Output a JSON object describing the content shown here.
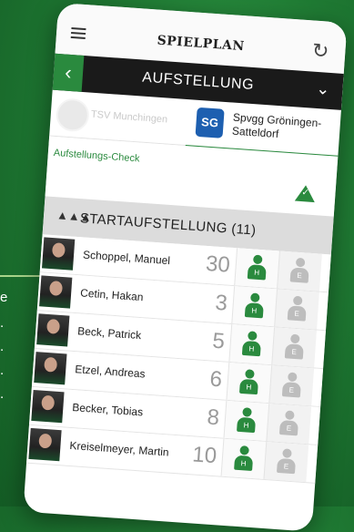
{
  "app": {
    "title": "SPIELPLAN"
  },
  "nav": {
    "section_title": "AUFSTELLUNG"
  },
  "teams": {
    "home": {
      "name": "TSV Munchingen"
    },
    "away": {
      "name": "Spvgg Gröningen-Satteldorf",
      "logo_text": "SG"
    }
  },
  "check": {
    "label": "Aufstellungs-Check"
  },
  "lineup": {
    "title": "STARTAUFSTELLUNG (11)",
    "role_letter_home": "H",
    "role_letter_away": "E",
    "players": [
      {
        "name": "Schoppel, Manuel",
        "number": "30"
      },
      {
        "name": "Cetin, Hakan",
        "number": "3"
      },
      {
        "name": "Beck, Patrick",
        "number": "5"
      },
      {
        "name": "Etzel, Andreas",
        "number": "6"
      },
      {
        "name": "Becker, Tobias",
        "number": "8"
      },
      {
        "name": "Kreiselmeyer, Martin",
        "number": "10"
      }
    ]
  },
  "colors": {
    "accent": "#2a8a3e",
    "background": "#1f7a33",
    "nav": "#1a1a1a"
  },
  "icons": [
    "menu-icon",
    "refresh-icon",
    "chevron-left-icon",
    "chevron-down-icon",
    "team-icon",
    "checkmark-icon",
    "person-icon"
  ]
}
